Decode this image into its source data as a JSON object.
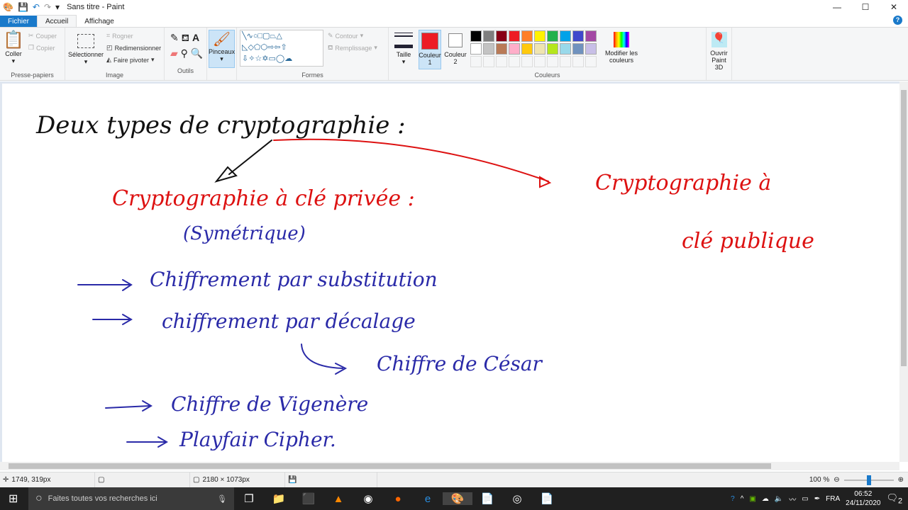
{
  "window": {
    "title": "Sans titre - Paint",
    "minimize": "—",
    "maximize": "☐",
    "close": "✕"
  },
  "tabs": [
    {
      "label": "Fichier"
    },
    {
      "label": "Accueil"
    },
    {
      "label": "Affichage"
    }
  ],
  "ribbon": {
    "clipboard": {
      "paste": "Coller",
      "cut": "Couper",
      "copy": "Copier",
      "label": "Presse-papiers"
    },
    "image": {
      "select": "Sélectionner",
      "crop": "Rogner",
      "resize": "Redimensionner",
      "rotate": "Faire pivoter",
      "label": "Image"
    },
    "tools": {
      "label": "Outils"
    },
    "brushes": {
      "label": "Pinceaux"
    },
    "shapes": {
      "outline": "Contour",
      "fill": "Remplissage",
      "label": "Formes"
    },
    "size": {
      "label": "Taille"
    },
    "color1": {
      "label": "Couleur 1",
      "value": "#ed1c24"
    },
    "color2": {
      "label": "Couleur 2",
      "value": "#ffffff"
    },
    "palette": [
      "#000000",
      "#7f7f7f",
      "#880015",
      "#ed1c24",
      "#ff7f27",
      "#fff200",
      "#22b14c",
      "#00a2e8",
      "#3f48cc",
      "#a349a4",
      "#ffffff",
      "#c3c3c3",
      "#b97a57",
      "#ffaec9",
      "#ffc90e",
      "#efe4b0",
      "#b5e61d",
      "#99d9ea",
      "#7092be",
      "#c8bfe7"
    ],
    "edit_colors": "Modifier les couleurs",
    "colors_label": "Couleurs",
    "paint3d": "Ouvrir Paint 3D"
  },
  "drawing": {
    "title": "Deux types de cryptographie :",
    "private": "Cryptographie à clé privée :",
    "symmetric": "(Symétrique)",
    "sub": "Chiffrement par substitution",
    "shift": "chiffrement par décalage",
    "caesar": "Chiffre de César",
    "vigenere": "Chiffre de Vigenère",
    "playfair": "Playfair Cipher.",
    "public1": "Cryptographie à",
    "public2": "clé publique"
  },
  "status": {
    "cursor": "1749, 319px",
    "size": "2180 × 1073px",
    "zoom": "100 %"
  },
  "taskbar": {
    "search": "Faites toutes vos recherches ici",
    "lang": "FRA",
    "time": "06:52",
    "date": "24/11/2020",
    "notif": "2"
  }
}
